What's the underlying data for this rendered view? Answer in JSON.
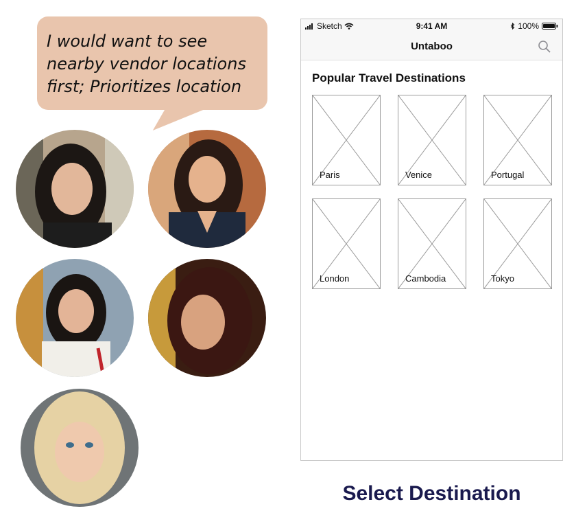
{
  "bubble": {
    "lines": [
      "I would want to see",
      "nearby vendor locations",
      "first; Prioritizes location"
    ]
  },
  "avatars": [
    {
      "name": "avatar-1"
    },
    {
      "name": "avatar-2"
    },
    {
      "name": "avatar-3"
    },
    {
      "name": "avatar-4"
    },
    {
      "name": "avatar-5"
    }
  ],
  "phone": {
    "status": {
      "carrier": "Sketch",
      "time": "9:41 AM",
      "battery": "100%"
    },
    "nav": {
      "title": "Untaboo"
    },
    "section_title": "Popular Travel Destinations",
    "destinations": [
      {
        "label": "Paris"
      },
      {
        "label": "Venice"
      },
      {
        "label": "Portugal"
      },
      {
        "label": "London"
      },
      {
        "label": "Cambodia"
      },
      {
        "label": "Tokyo"
      }
    ]
  },
  "caption": "Select Destination",
  "colors": {
    "bubble": "#e9c5ad",
    "caption": "#1a1a4e"
  }
}
